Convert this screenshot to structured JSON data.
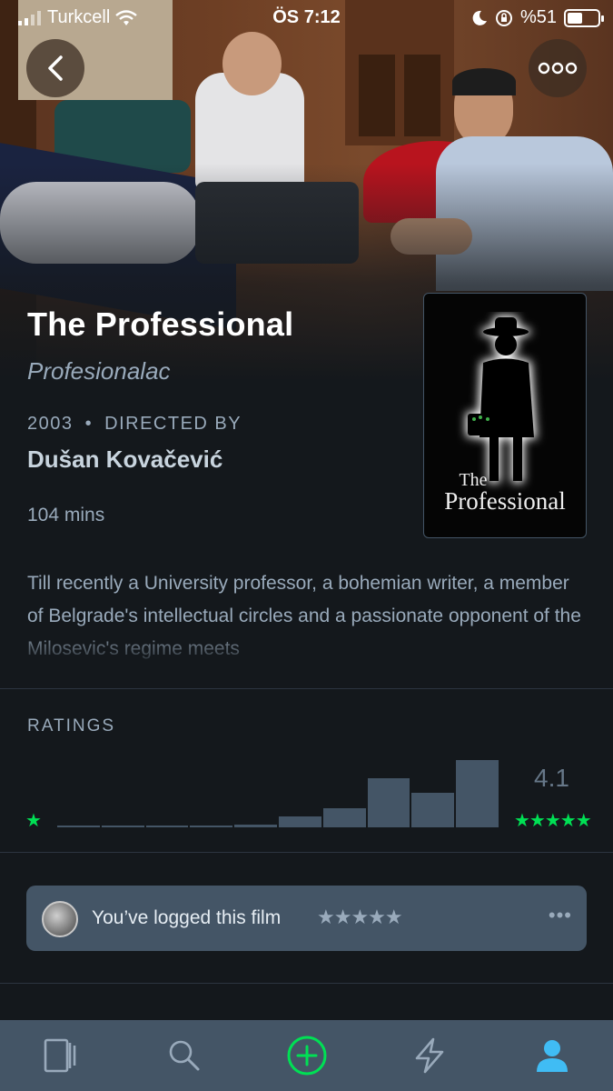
{
  "status_bar": {
    "carrier": "Turkcell",
    "time": "ÖS 7:12",
    "battery": "%51"
  },
  "film": {
    "title": "The Professional",
    "original_title": "Profesionalac",
    "year": "2003",
    "meta_separator": "•",
    "directed_by_label": "DIRECTED BY",
    "director": "Dušan Kovačević",
    "runtime": "104 mins",
    "synopsis": "Till recently a University professor, a bohemian writer, a member of Belgrade's intellectual circles and a passionate opponent of the Milosevic's regime meets",
    "poster": {
      "line1": "The",
      "line2": "Professional"
    }
  },
  "ratings": {
    "label": "RATINGS",
    "min_star": "★",
    "max_stars": "★★★★★",
    "average": "4.1",
    "distribution": [
      0.01,
      0.01,
      0.01,
      0.01,
      0.04,
      0.16,
      0.29,
      0.73,
      0.52,
      1.0
    ]
  },
  "log": {
    "text": "You’ve logged this film",
    "stars": "★★★★★",
    "more": "•••"
  },
  "colors": {
    "background": "#14181c",
    "accent_green": "#00e054",
    "slate": "#445566",
    "muted_text": "#99aabb"
  },
  "icons": {
    "back": "chevron-left-icon",
    "more": "more-dots-icon",
    "tab_films": "films-icon",
    "tab_search": "search-icon",
    "tab_add": "add-icon",
    "tab_activity": "lightning-icon",
    "tab_profile": "profile-icon"
  }
}
